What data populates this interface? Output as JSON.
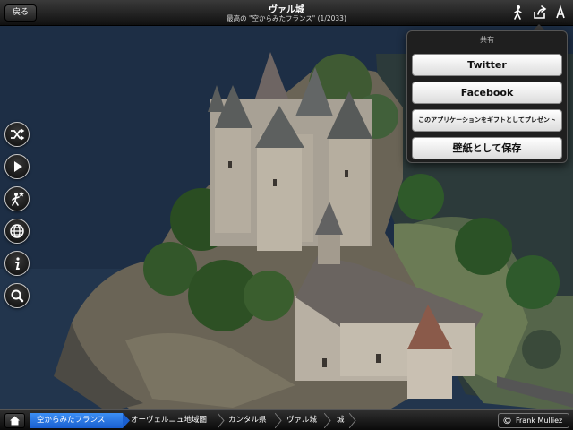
{
  "header": {
    "back_label": "戻る",
    "title": "ヴァル城",
    "subtitle": "最高の \"空からみたフランス\" (1/2033)",
    "walk_icon": "walking-person-icon",
    "share_icon": "share-icon",
    "font_icon": "font-size-icon"
  },
  "share_popover": {
    "heading": "共有",
    "buttons": [
      "Twitter",
      "Facebook",
      "このアプリケーションをギフトとしてプレゼント",
      "壁紙として保存"
    ]
  },
  "toolbar": {
    "icons": [
      "shuffle-icon",
      "play-icon",
      "favorite-person-icon",
      "globe-icon",
      "info-icon",
      "search-icon"
    ]
  },
  "breadcrumb": {
    "items": [
      "空からみたフランス",
      "オーヴェルニュ地域圏",
      "カンタル県",
      "ヴァル城",
      "城"
    ],
    "active_index": 0
  },
  "credit": {
    "symbol": "©",
    "text": "Frank Mulliez"
  },
  "colors": {
    "accent": "#2f7ff0",
    "bar": "#1a1a1a"
  }
}
